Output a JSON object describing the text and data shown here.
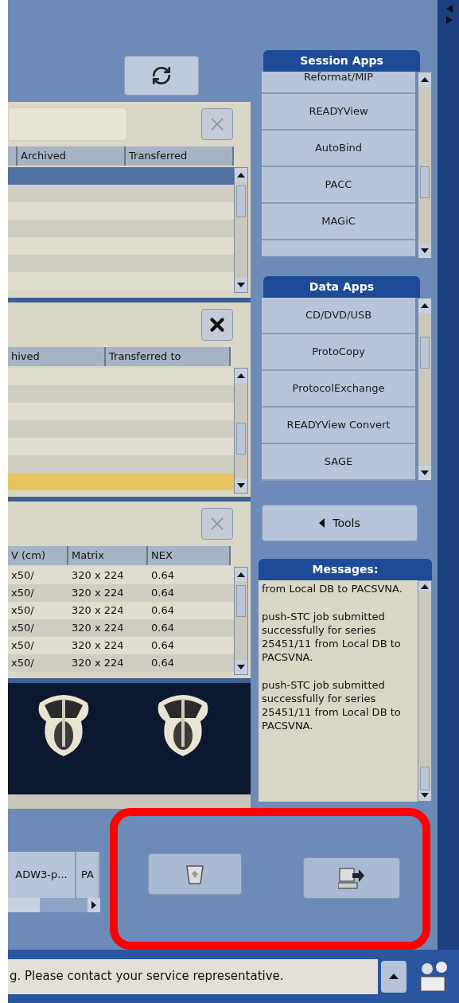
{
  "panels": [
    {
      "has_filter_field": true,
      "clear_button": {
        "disabled": true
      },
      "columns": [
        "",
        "Archived",
        "Transferred"
      ],
      "rows": [
        {
          "selected": true,
          "highlighted": false,
          "cells": []
        },
        {
          "selected": false,
          "highlighted": false,
          "cells": []
        },
        {
          "selected": false,
          "highlighted": false,
          "cells": []
        },
        {
          "selected": false,
          "highlighted": false,
          "cells": []
        },
        {
          "selected": false,
          "highlighted": false,
          "cells": []
        },
        {
          "selected": false,
          "highlighted": false,
          "cells": []
        },
        {
          "selected": false,
          "highlighted": false,
          "cells": []
        }
      ]
    },
    {
      "has_filter_field": false,
      "clear_button": {
        "disabled": false
      },
      "columns": [
        "hived",
        "Transferred to"
      ],
      "rows": [
        {
          "selected": false,
          "highlighted": false,
          "cells": []
        },
        {
          "selected": false,
          "highlighted": false,
          "cells": []
        },
        {
          "selected": false,
          "highlighted": false,
          "cells": []
        },
        {
          "selected": false,
          "highlighted": false,
          "cells": []
        },
        {
          "selected": false,
          "highlighted": false,
          "cells": []
        },
        {
          "selected": false,
          "highlighted": false,
          "cells": []
        },
        {
          "selected": false,
          "highlighted": true,
          "cells": []
        }
      ]
    },
    {
      "has_filter_field": false,
      "clear_button": {
        "disabled": true
      },
      "columns": [
        "V (cm)",
        "Matrix",
        "NEX"
      ],
      "rows": [
        {
          "selected": false,
          "highlighted": false,
          "cells": [
            "x50/",
            "320 x 224",
            "0.64"
          ]
        },
        {
          "selected": false,
          "highlighted": false,
          "cells": [
            "x50/",
            "320 x 224",
            "0.64"
          ]
        },
        {
          "selected": false,
          "highlighted": false,
          "cells": [
            "x50/",
            "320 x 224",
            "0.64"
          ]
        },
        {
          "selected": false,
          "highlighted": false,
          "cells": [
            "x50/",
            "320 x 224",
            "0.64"
          ]
        },
        {
          "selected": false,
          "highlighted": false,
          "cells": [
            "x50/",
            "320 x 224",
            "0.64"
          ]
        },
        {
          "selected": false,
          "highlighted": false,
          "cells": [
            "x50/",
            "320 x 224",
            "0.64"
          ]
        }
      ]
    }
  ],
  "viewer": {
    "images": [
      {
        "kind": "picture"
      },
      {
        "kind": "picture"
      }
    ]
  },
  "bottom_tabs": [
    "ADW3-p...",
    "PA"
  ],
  "status_message": "g. Please contact your service representative.",
  "session_apps": {
    "title": "Session Apps",
    "items": [
      "Reformat/MIP",
      "READYView",
      "AutoBind",
      "PACC",
      "MAGiC"
    ]
  },
  "data_apps": {
    "title": "Data Apps",
    "items": [
      "CD/DVD/USB",
      "ProtoCopy",
      "ProtocolExchange",
      "READYView Convert",
      "SAGE"
    ]
  },
  "tools_button": "Tools",
  "messages": {
    "title": "Messages:",
    "entries": [
      "from Local DB to PACSVNA.",
      "push-STC job submitted successfully for series 25451/11 from Local DB to PACSVNA.",
      "push-STC job submitted successfully for series 25451/11 from Local DB to PACSVNA."
    ]
  }
}
